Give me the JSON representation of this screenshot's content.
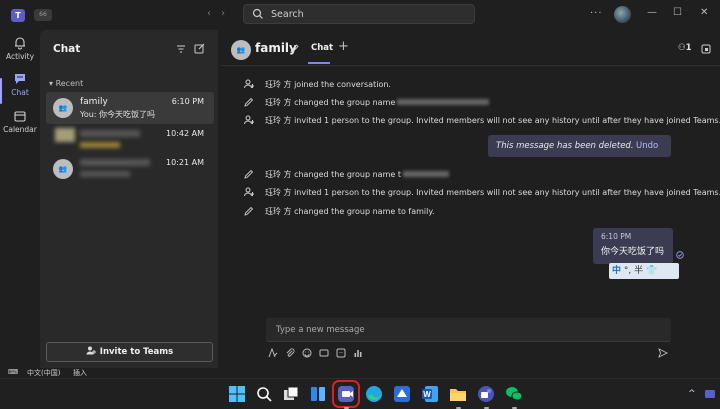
{
  "titlebar": {
    "back_label": "66",
    "search_label": "Search",
    "more_label": "···",
    "win_min": "—",
    "win_max": "☐",
    "win_close": "✕"
  },
  "rail": {
    "items": [
      {
        "label": "Activity",
        "icon": "bell-icon",
        "active": false
      },
      {
        "label": "Chat",
        "icon": "chat-icon",
        "active": true
      },
      {
        "label": "Calendar",
        "icon": "calendar-icon",
        "active": false
      }
    ]
  },
  "chatlist": {
    "title": "Chat",
    "section": "Recent",
    "rows": [
      {
        "name": "family",
        "time": "6:10 PM",
        "preview": "You: 你今天吃饭了吗",
        "avatar": "⁠"
      },
      {
        "name": "",
        "time": "10:42 AM",
        "preview": ""
      },
      {
        "name": "",
        "time": "10:21 AM",
        "preview": ""
      }
    ],
    "invite_label": "Invite to Teams"
  },
  "conversation": {
    "title": "family",
    "tab_label": "Chat",
    "add_tab": "+",
    "people_count": "1",
    "events": [
      {
        "icon": "person-add-icon",
        "text": "珏玲 方 joined the conversation.",
        "blurred": false
      },
      {
        "icon": "pencil-icon",
        "text": "珏玲 方 changed the group name",
        "blurred": true
      },
      {
        "icon": "person-add-icon",
        "text": "珏玲 方 invited 1 person to the group. Invited members will not see any history until after they have joined Teams.",
        "blurred": false
      },
      {
        "icon": "pencil-icon",
        "text": "珏玲 方 changed the group name t",
        "blurred": true
      },
      {
        "icon": "person-add-icon",
        "text": "珏玲 方 invited 1 person to the group. Invited members will not see any history until after they have joined Teams.",
        "blurred": false
      },
      {
        "icon": "pencil-icon",
        "text": "珏玲 方 changed the group name to family.",
        "blurred": false
      }
    ],
    "deleted_text": "This message has been deleted.",
    "undo_label": "Undo",
    "my_message": {
      "time": "6:10 PM",
      "text": "你今天吃饭了吗"
    },
    "ime_bar": {
      "mode": "中",
      "rest": "°, 半 👕"
    },
    "compose_placeholder": "Type a new message"
  },
  "statusbar": {
    "lang": "中文(中国)",
    "mode": "插入"
  },
  "taskbar": {
    "apps": [
      "windows-start-icon",
      "search-icon",
      "task-view-icon",
      "widgets-icon",
      "teams-icon",
      "edge-icon",
      "app-icon",
      "word-icon",
      "file-explorer-icon",
      "teams-work-icon",
      "wechat-icon"
    ],
    "tray_chevron": "^"
  },
  "colors": {
    "accent": "#7f85f5",
    "bubble": "#3b3c52",
    "highlight": "#e02020"
  }
}
